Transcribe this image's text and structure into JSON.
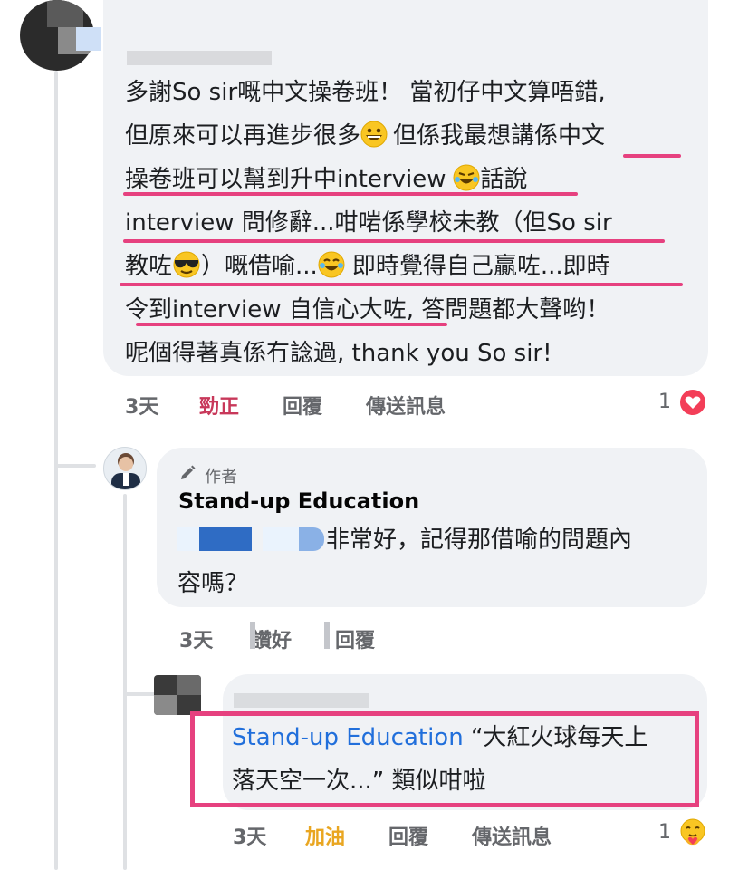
{
  "comment1": {
    "lines": [
      "多謝So sir嘅中文操卷班！ 當初仔中文算唔錯,",
      "但原來可以再進步很多",
      "但係我最想講係中文",
      "操卷班可以幫到升中interview",
      "話說",
      "interview 問修辭...咁啱係學校未教（但So sir",
      "教咗",
      "）嘅借喻...",
      "即時覺得自己贏咗...即時",
      "令到interview 自信心大咗, 答問題都大聲哟！",
      "呢個得著真係冇諗過, thank you So sir!"
    ],
    "actions": {
      "time": "3天",
      "like": "勁正",
      "reply": "回覆",
      "message": "傳送訊息"
    },
    "reaction_count": "1",
    "colors": {
      "like": "#c8385a",
      "reaction": "#f33e58"
    }
  },
  "reply1": {
    "author_tag": "作者",
    "name": "Stand-up Education",
    "text_line1": "非常好，記得那借喻的問題內",
    "text_line2": "容嗎？",
    "actions": {
      "time": "3天",
      "like": "讚好",
      "reply": "回覆"
    }
  },
  "reply2": {
    "mention": "Stand-up Education",
    "text_line1": " “大紅火球每天上",
    "text_line2": "落天空一次...” 類似咁啦",
    "actions": {
      "time": "3天",
      "like": "加油",
      "reply": "回覆",
      "message": "傳送訊息"
    },
    "reaction_count": "1",
    "colors": {
      "like": "#e9a621"
    }
  },
  "colors": {
    "underline": "#e6417f",
    "bubble": "#f0f2f5"
  }
}
